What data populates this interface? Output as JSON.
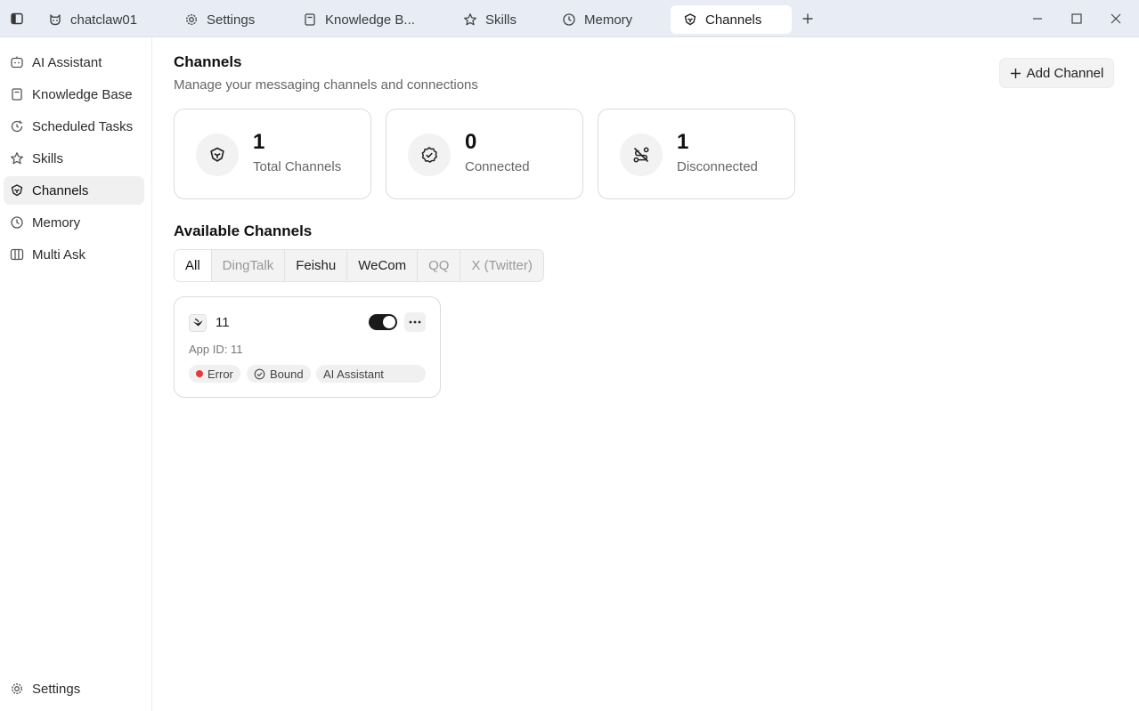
{
  "titlebar": {
    "tabs": [
      {
        "label": "chatclaw01",
        "icon": "cat-icon"
      },
      {
        "label": "Settings",
        "icon": "gear-icon"
      },
      {
        "label": "Knowledge B...",
        "icon": "book-icon"
      },
      {
        "label": "Skills",
        "icon": "star-icon"
      },
      {
        "label": "Memory",
        "icon": "clock-icon"
      },
      {
        "label": "Channels",
        "icon": "channels-icon",
        "active": true
      }
    ]
  },
  "sidebar": {
    "items": [
      {
        "label": "AI Assistant",
        "icon": "robot-icon"
      },
      {
        "label": "Knowledge Base",
        "icon": "book-icon"
      },
      {
        "label": "Scheduled Tasks",
        "icon": "clock-refresh-icon"
      },
      {
        "label": "Skills",
        "icon": "star-icon"
      },
      {
        "label": "Channels",
        "icon": "channels-icon",
        "active": true
      },
      {
        "label": "Memory",
        "icon": "clock-icon"
      },
      {
        "label": "Multi Ask",
        "icon": "columns-icon"
      }
    ],
    "settings_label": "Settings"
  },
  "main": {
    "title": "Channels",
    "subtitle": "Manage your messaging channels and connections",
    "add_button": "Add Channel",
    "stats": [
      {
        "value": "1",
        "label": "Total Channels"
      },
      {
        "value": "0",
        "label": "Connected"
      },
      {
        "value": "1",
        "label": "Disconnected"
      }
    ],
    "section_title": "Available Channels",
    "filters": [
      "All",
      "DingTalk",
      "Feishu",
      "WeCom",
      "QQ",
      "X (Twitter)"
    ],
    "selected_filter": "All",
    "channel": {
      "name": "11",
      "app_id": "App ID: 11",
      "enabled": true,
      "status": "Error",
      "bound": "Bound",
      "assistant": "AI Assistant"
    }
  },
  "colors": {
    "titlebar_bg": "#e8edf5",
    "error_dot": "#e5383b",
    "toggle_on": "#1a1a1a"
  }
}
